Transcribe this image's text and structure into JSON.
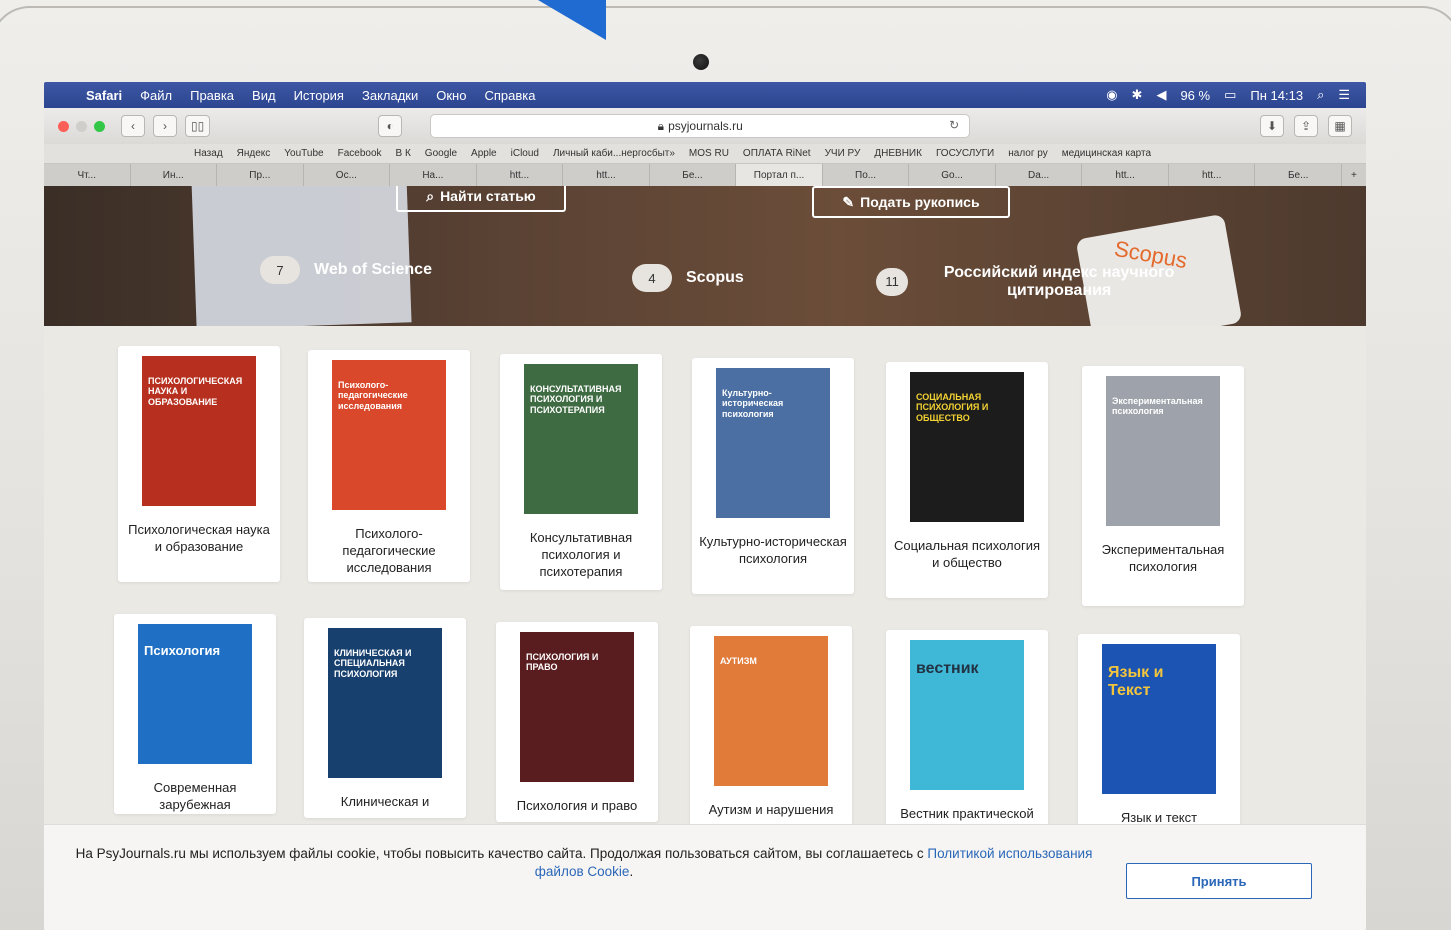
{
  "menubar": {
    "app": "Safari",
    "items": [
      "Файл",
      "Правка",
      "Вид",
      "История",
      "Закладки",
      "Окно",
      "Справка"
    ],
    "battery": "96 %",
    "clock": "Пн 14:13"
  },
  "toolbar": {
    "url": "psyjournals.ru"
  },
  "bookmarks": [
    "Назад",
    "Яндекс",
    "YouTube",
    "Facebook",
    "В К",
    "Google",
    "Apple",
    "iCloud",
    "Личный каби...нергосбыт»",
    "MOS RU",
    "ОПЛАТА RiNet",
    "УЧИ РУ",
    "ДНЕВНИК",
    "ГОСУСЛУГИ",
    "налог ру",
    "медицинская карта"
  ],
  "tabs": [
    "Чт...",
    "Ин...",
    "Пр...",
    "Ос...",
    "На...",
    "htt...",
    "htt...",
    "Бе...",
    "Портал п...",
    "По...",
    "Go...",
    "Da...",
    "htt...",
    "htt...",
    "Бе..."
  ],
  "hero": {
    "find_article": "Найти статью",
    "submit_manuscript": "Подать рукопись",
    "metrics": [
      {
        "count": "7",
        "label": "Web of Science"
      },
      {
        "count": "4",
        "label": "Scopus"
      },
      {
        "count": "11",
        "label": "Российский индекс научного цитирования"
      }
    ],
    "scopus_sticker": "Scopus"
  },
  "journals": [
    {
      "title": "Психологическая наука и образование",
      "cover_text": "ПСИХОЛОГИЧЕСКАЯ НАУКА И ОБРАЗОВАНИЕ",
      "color": "#b7301f"
    },
    {
      "title": "Психолого-педагогические исследования",
      "cover_text": "Психолого-педагогические исследования",
      "color": "#d9482a"
    },
    {
      "title": "Консультативная психология и психотерапия",
      "cover_text": "КОНСУЛЬТАТИВНАЯ ПСИХОЛОГИЯ И ПСИХОТЕРАПИЯ",
      "color": "#3f6b43"
    },
    {
      "title": "Культурно-историческая психология",
      "cover_text": "Культурно-историческая психология",
      "color": "#4b6fa3"
    },
    {
      "title": "Социальная психология и общество",
      "cover_text": "СОЦИАЛЬНАЯ ПСИХОЛОГИЯ И ОБЩЕСТВО",
      "color": "#1c1c1c"
    },
    {
      "title": "Экспериментальная психология",
      "cover_text": "Экспериментальная психология",
      "color": "#9ea3ab"
    },
    {
      "title": "Современная зарубежная",
      "cover_text": "Психология",
      "color": "#1f70c4"
    },
    {
      "title": "Клиническая и",
      "cover_text": "КЛИНИЧЕСКАЯ И СПЕЦИАЛЬНАЯ ПСИХОЛОГИЯ",
      "color": "#17406f"
    },
    {
      "title": "Психология и право",
      "cover_text": "ПСИХОЛОГИЯ И ПРАВО",
      "color": "#5a1d1f"
    },
    {
      "title": "Аутизм и нарушения",
      "cover_text": "АУТИЗМ",
      "color": "#e07b3a"
    },
    {
      "title": "Вестник практической",
      "cover_text": "вестник",
      "color": "#3fb7d6"
    },
    {
      "title": "Язык и текст",
      "cover_text": "Язык и Текст",
      "color": "#1b54b2"
    }
  ],
  "cookie": {
    "text": "На PsyJournals.ru мы используем файлы cookie, чтобы повысить качество сайта. Продолжая пользоваться сайтом, вы соглашаетесь с ",
    "link": "Политикой использования файлов Cookie",
    "end": ".",
    "accept": "Принять"
  }
}
